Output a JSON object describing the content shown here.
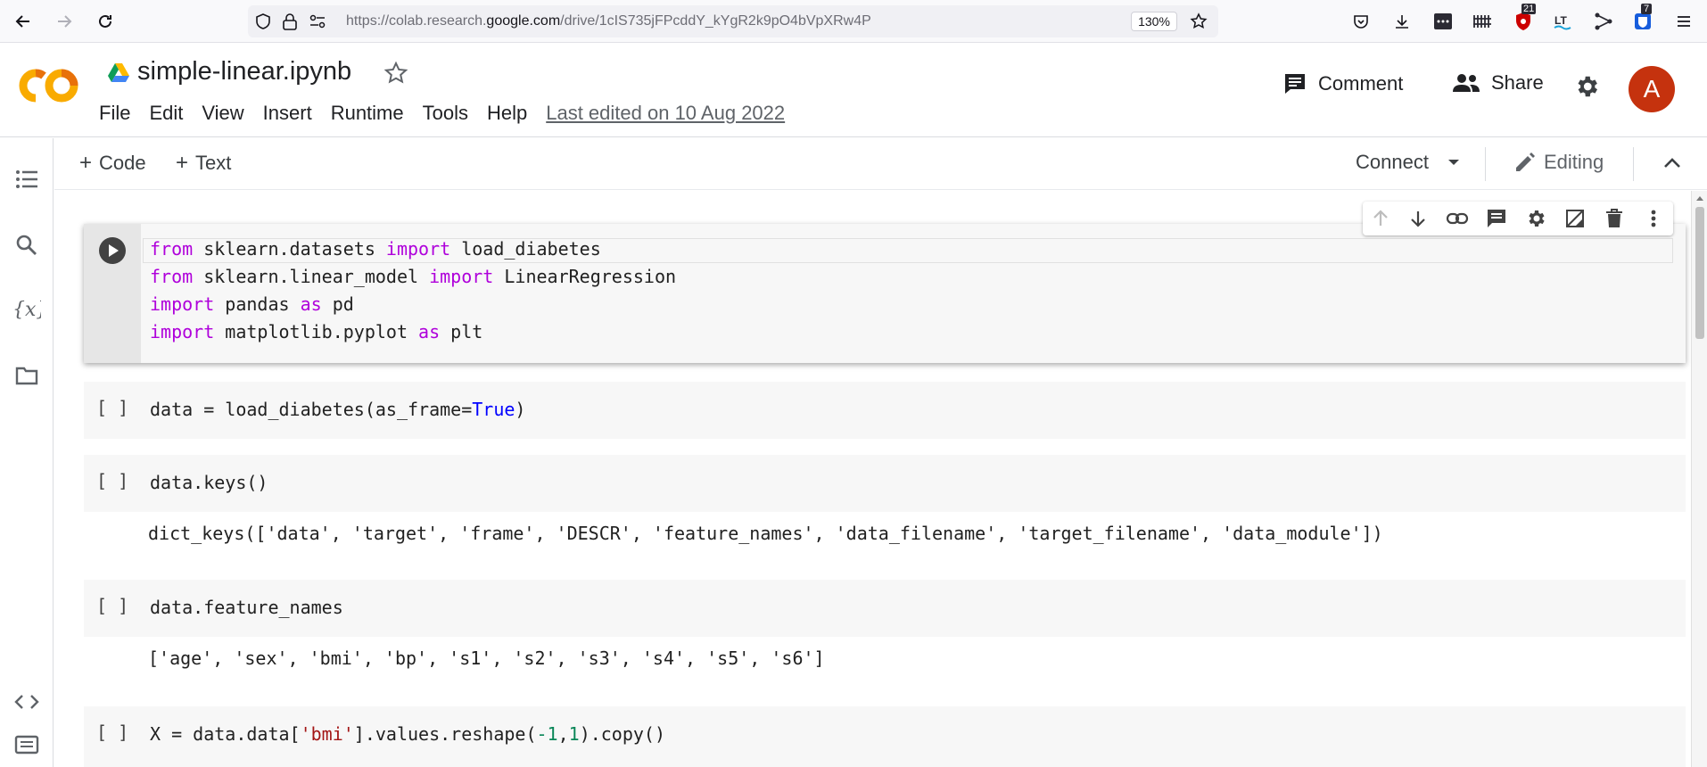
{
  "browser": {
    "url_prefix": "https://colab.research.",
    "url_domain": "google.com",
    "url_path": "/drive/1cIS735jFPcddY_kYgR2k9pO4bVpXRw4P",
    "zoom": "130%",
    "badge_counts": [
      "21",
      "7"
    ]
  },
  "header": {
    "logo": "CO",
    "title": "simple-linear.ipynb",
    "menu": [
      "File",
      "Edit",
      "View",
      "Insert",
      "Runtime",
      "Tools",
      "Help"
    ],
    "last_edited": "Last edited on 10 Aug 2022",
    "comment_label": "Comment",
    "share_label": "Share",
    "avatar_letter": "A"
  },
  "toolbar": {
    "add_code": "Code",
    "add_text": "Text",
    "connect": "Connect",
    "editing": "Editing"
  },
  "cells": {
    "c1": {
      "l1a": "from",
      "l1b": " sklearn.datasets ",
      "l1c": "import",
      "l1d": " load_diabetes",
      "l2a": "from",
      "l2b": " sklearn.linear_model ",
      "l2c": "import",
      "l2d": " LinearRegression",
      "l3a": "import",
      "l3b": " pandas ",
      "l3c": "as",
      "l3d": " pd",
      "l4a": "import",
      "l4b": " matplotlib.pyplot ",
      "l4c": "as",
      "l4d": " plt"
    },
    "c2": {
      "bracket": "[ ]",
      "a": "data = load_diabetes(as_frame=",
      "b": "True",
      "c": ")"
    },
    "c3": {
      "bracket": "[ ]",
      "code": "data.keys()",
      "output": "dict_keys(['data', 'target', 'frame', 'DESCR', 'feature_names', 'data_filename', 'target_filename', 'data_module'])"
    },
    "c4": {
      "bracket": "[ ]",
      "code": "data.feature_names",
      "output": "['age', 'sex', 'bmi', 'bp', 's1', 's2', 's3', 's4', 's5', 's6']"
    },
    "c5": {
      "bracket": "[ ]",
      "a": "X = data.data[",
      "b": "'bmi'",
      "c": "].values.reshape(",
      "d": "-1",
      "e": ",",
      "f": "1",
      "g": ").copy()"
    }
  }
}
